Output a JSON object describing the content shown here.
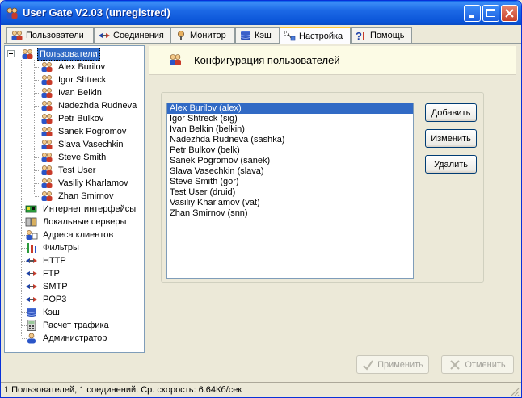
{
  "window": {
    "title": "User Gate V2.03 (unregistred)"
  },
  "tabs": [
    {
      "label": "Пользователи",
      "icon": "users-icon"
    },
    {
      "label": "Соединения",
      "icon": "connections-icon"
    },
    {
      "label": "Монитор",
      "icon": "monitor-icon"
    },
    {
      "label": "Кэш",
      "icon": "cache-icon"
    },
    {
      "label": "Настройка",
      "icon": "settings-icon",
      "active": true
    },
    {
      "label": "Помощь",
      "icon": "help-icon"
    }
  ],
  "tree": {
    "root": "Пользователи",
    "users": [
      "Alex Burilov",
      "Igor Shtreck",
      "Ivan Belkin",
      "Nadezhda Rudneva",
      "Petr Bulkov",
      "Sanek Pogromov",
      "Slava Vasechkin",
      "Steve Smith",
      "Test User",
      "Vasiliy Kharlamov",
      "Zhan Smirnov"
    ],
    "sections": [
      {
        "label": "Интернет интерфейсы",
        "icon": "network-card-icon"
      },
      {
        "label": "Локальные серверы",
        "icon": "servers-icon"
      },
      {
        "label": "Адреса клиентов",
        "icon": "client-address-icon"
      },
      {
        "label": "Фильтры",
        "icon": "filter-icon"
      },
      {
        "label": "HTTP",
        "icon": "protocol-icon"
      },
      {
        "label": "FTP",
        "icon": "protocol-icon"
      },
      {
        "label": "SMTP",
        "icon": "protocol-icon"
      },
      {
        "label": "POP3",
        "icon": "protocol-icon"
      },
      {
        "label": "Кэш",
        "icon": "cache-icon"
      },
      {
        "label": "Расчет трафика",
        "icon": "calculator-icon"
      },
      {
        "label": "Администратор",
        "icon": "admin-icon"
      }
    ]
  },
  "panel": {
    "title": "Конфигурация пользователей",
    "users_list": [
      "Alex Burilov  (alex)",
      "Igor Shtreck  (sig)",
      "Ivan Belkin  (belkin)",
      "Nadezhda Rudneva  (sashka)",
      "Petr Bulkov  (belk)",
      "Sanek Pogromov  (sanek)",
      "Slava Vasechkin  (slava)",
      "Steve Smith  (gor)",
      "Test User  (druid)",
      "Vasiliy Kharlamov  (vat)",
      "Zhan Smirnov  (snn)"
    ],
    "selected_index": 0,
    "buttons": {
      "add": "Добавить",
      "edit": "Изменить",
      "delete": "Удалить"
    }
  },
  "footer": {
    "apply": "Применить",
    "cancel": "Отменить"
  },
  "status": {
    "text": "1 Пользователей, 1 соединений. Ср. скорость: 6.64Кб/сек"
  },
  "colors": {
    "titlebar": "#0a55d8",
    "selection": "#316ac5",
    "active_tab_accent": "#ffc83c"
  }
}
